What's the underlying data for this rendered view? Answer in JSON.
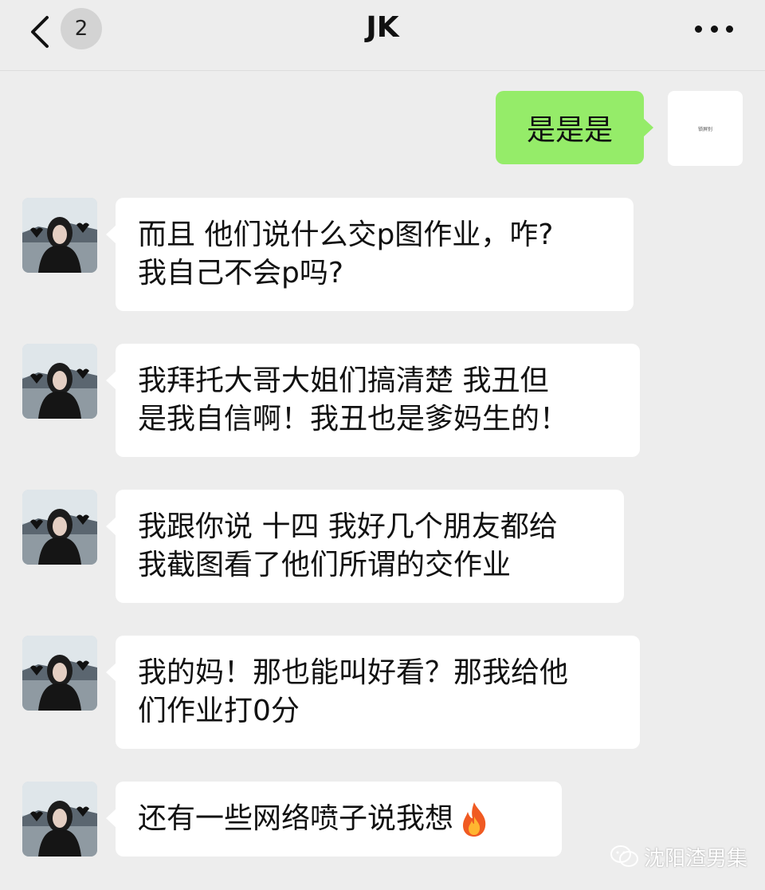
{
  "header": {
    "back_icon": "chevron-left-icon",
    "unread_count": "2",
    "title": "JK",
    "more_icon": "ellipsis-icon"
  },
  "messages": [
    {
      "sender": "self",
      "lines": [
        "是是是"
      ],
      "avatar_text": "锁屏别"
    },
    {
      "sender": "other",
      "lines": [
        "而且 他们说什么交p图作业，咋?",
        "我自己不会p吗?"
      ]
    },
    {
      "sender": "other",
      "lines": [
        "我拜托大哥大姐们搞清楚 我丑但",
        "是我自信啊！我丑也是爹妈生的！"
      ]
    },
    {
      "sender": "other",
      "lines": [
        "我跟你说 十四 我好几个朋友都给",
        "我截图看了他们所谓的交作业"
      ]
    },
    {
      "sender": "other",
      "lines": [
        "我的妈！那也能叫好看？那我给他",
        "们作业打0分"
      ]
    },
    {
      "sender": "other",
      "lines": [
        "还有一些网络喷子说我想"
      ],
      "emoji": "fire-icon"
    }
  ],
  "watermark": {
    "text": "沈阳渣男集",
    "icon": "wechat-icon"
  },
  "colors": {
    "background": "#ededed",
    "self_bubble": "#95ec69",
    "other_bubble": "#ffffff"
  }
}
